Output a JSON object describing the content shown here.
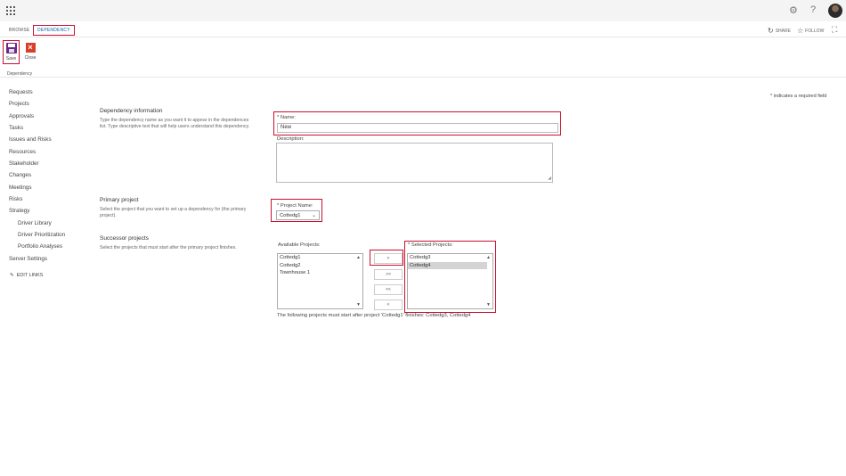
{
  "suitebar": {
    "help_label": "?"
  },
  "ribbon": {
    "tabs": [
      {
        "label": "BROWSE"
      },
      {
        "label": "DEPENDENCY"
      }
    ],
    "actions": {
      "share_label": "SHARE",
      "follow_label": "FOLLOW"
    },
    "save_label": "Save",
    "close_label": "Close",
    "group_label": "Dependency"
  },
  "nav": {
    "items": [
      {
        "label": "Requests"
      },
      {
        "label": "Projects"
      },
      {
        "label": "Approvals"
      },
      {
        "label": "Tasks"
      },
      {
        "label": "Issues and Risks"
      },
      {
        "label": "Resources"
      },
      {
        "label": "Stakeholder"
      },
      {
        "label": "Changes"
      },
      {
        "label": "Meetings"
      },
      {
        "label": "Risks"
      },
      {
        "label": "Strategy"
      },
      {
        "label": "Driver Library"
      },
      {
        "label": "Driver Prioritization"
      },
      {
        "label": "Portfolio Analyses"
      },
      {
        "label": "Server Settings"
      }
    ],
    "edit_links": "EDIT LINKS"
  },
  "form": {
    "required_note": "* indicates a required field",
    "dependency_info": {
      "title": "Dependency information",
      "desc": "Type the dependency name as you want it to appear in the dependences list. Type descriptive text that will help users understand this dependency.",
      "name_label": "* Name:",
      "name_value": "New",
      "description_label": "Description:"
    },
    "primary": {
      "title": "Primary project",
      "desc": "Select the project that you want to set up a dependency for (the primary project).",
      "project_name_label": "* Project Name:",
      "project_name_value": "Cottedg1"
    },
    "successor": {
      "title": "Successor projects",
      "desc": "Select the projects that must start after the primary project finishes.",
      "available_label": "Available Projects:",
      "available": [
        "Cottedg1",
        "Cottedg2",
        "Townhouse 1"
      ],
      "selected_label": "* Selected Projects:",
      "selected": [
        "Cottedg3",
        "Cottedg4"
      ],
      "buttons": [
        ">",
        ">>",
        "<<",
        "<"
      ],
      "footnote": "The following projects must start after project 'Cottedg1' finishes: Cottedg3, Cottedg4"
    }
  },
  "colors": {
    "highlight": "#c8102e",
    "link": "#0a5ea8",
    "save_icon": "#6b2a8b",
    "close_icon": "#d9402b"
  }
}
